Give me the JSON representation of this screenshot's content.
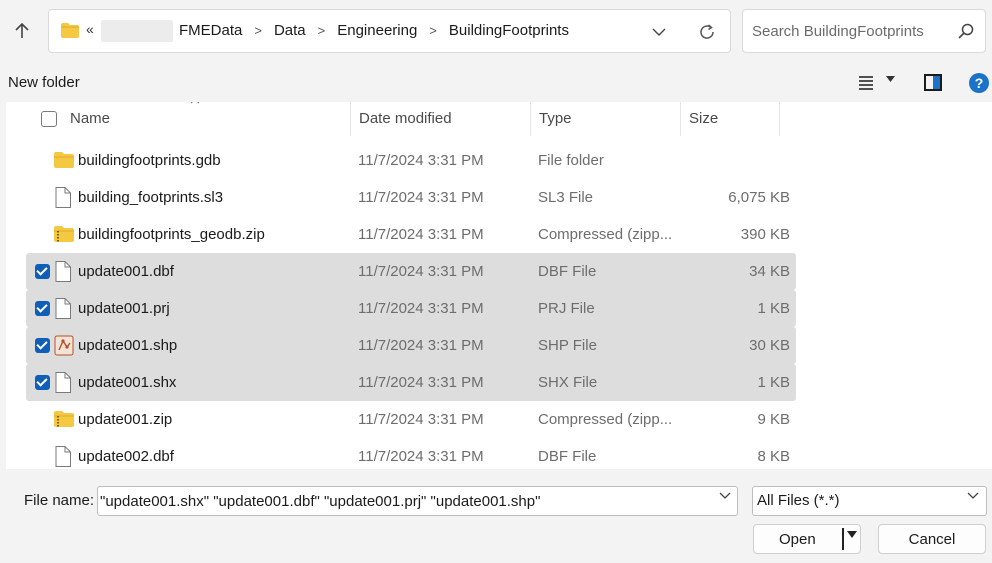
{
  "address": {
    "overflow_glyph": "«",
    "crumbs": [
      "FMEData",
      "Data",
      "Engineering",
      "BuildingFootprints"
    ],
    "separator": ">"
  },
  "search": {
    "placeholder": "Search BuildingFootprints"
  },
  "command_bar": {
    "new_folder_label": "New folder",
    "help_label": "?"
  },
  "columns": {
    "name": "Name",
    "date": "Date modified",
    "type": "Type",
    "size": "Size"
  },
  "files": [
    {
      "name": "buildingfootprints.gdb",
      "date": "11/7/2024 3:31 PM",
      "type": "File folder",
      "size": "",
      "icon": "folder-icon",
      "selected": false
    },
    {
      "name": "building_footprints.sl3",
      "date": "11/7/2024 3:31 PM",
      "type": "SL3 File",
      "size": "6,075 KB",
      "icon": "file-icon",
      "selected": false
    },
    {
      "name": "buildingfootprints_geodb.zip",
      "date": "11/7/2024 3:31 PM",
      "type": "Compressed (zipp...",
      "size": "390 KB",
      "icon": "zip-folder-icon",
      "selected": false
    },
    {
      "name": "update001.dbf",
      "date": "11/7/2024 3:31 PM",
      "type": "DBF File",
      "size": "34 KB",
      "icon": "file-icon",
      "selected": true
    },
    {
      "name": "update001.prj",
      "date": "11/7/2024 3:31 PM",
      "type": "PRJ File",
      "size": "1 KB",
      "icon": "file-icon",
      "selected": true
    },
    {
      "name": "update001.shp",
      "date": "11/7/2024 3:31 PM",
      "type": "SHP File",
      "size": "30 KB",
      "icon": "shp-file-icon",
      "selected": true
    },
    {
      "name": "update001.shx",
      "date": "11/7/2024 3:31 PM",
      "type": "SHX File",
      "size": "1 KB",
      "icon": "file-icon",
      "selected": true
    },
    {
      "name": "update001.zip",
      "date": "11/7/2024 3:31 PM",
      "type": "Compressed (zipp...",
      "size": "9 KB",
      "icon": "zip-folder-icon",
      "selected": false
    },
    {
      "name": "update002.dbf",
      "date": "11/7/2024 3:31 PM",
      "type": "DBF File",
      "size": "8 KB",
      "icon": "file-icon",
      "selected": false
    }
  ],
  "footer": {
    "file_name_label": "File name:",
    "file_name_value": "\"update001.shx\" \"update001.dbf\" \"update001.prj\" \"update001.shp\"",
    "filter_value": "All Files (*.*)",
    "open_label": "Open",
    "cancel_label": "Cancel"
  },
  "colors": {
    "accent": "#0f5fb8",
    "selection": "#dddddd",
    "folder": "#f5c842"
  }
}
